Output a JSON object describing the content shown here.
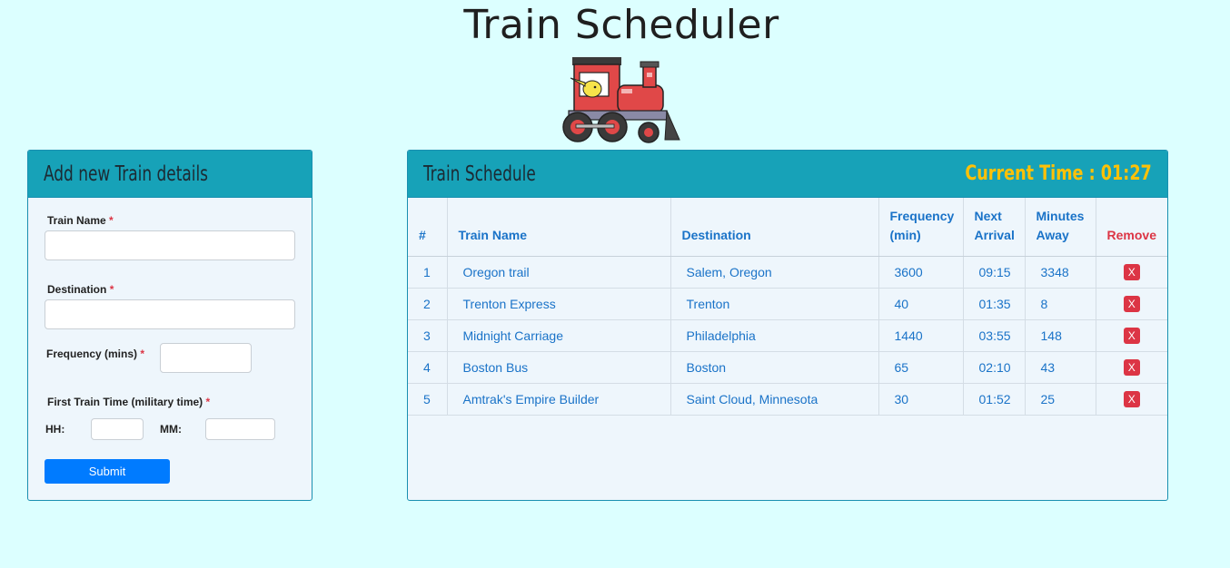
{
  "page": {
    "title": "Train Scheduler"
  },
  "form": {
    "title": "Add new Train details",
    "fields": {
      "train_name": {
        "label": "Train Name",
        "value": ""
      },
      "destination": {
        "label": "Destination",
        "value": ""
      },
      "frequency": {
        "label": "Frequency (mins)",
        "value": ""
      },
      "first_time": {
        "label": "First Train Time (military time)"
      },
      "hh": {
        "label": "HH:",
        "value": ""
      },
      "mm": {
        "label": "MM:",
        "value": ""
      }
    },
    "required_mark": "*",
    "submit_label": "Submit"
  },
  "schedule": {
    "title": "Train Schedule",
    "current_time": "Current Time : 01:27",
    "columns": [
      "#",
      "Train Name",
      "Destination",
      "Frequency (min)",
      "Next Arrival",
      "Minutes Away",
      "Remove"
    ],
    "remove_label": "X",
    "rows": [
      {
        "num": "1",
        "name": "Oregon trail",
        "destination": "Salem, Oregon",
        "frequency": "3600",
        "next": "09:15",
        "away": "3348"
      },
      {
        "num": "2",
        "name": "Trenton Express",
        "destination": "Trenton",
        "frequency": "40",
        "next": "01:35",
        "away": "8"
      },
      {
        "num": "3",
        "name": "Midnight Carriage",
        "destination": "Philadelphia",
        "frequency": "1440",
        "next": "03:55",
        "away": "148"
      },
      {
        "num": "4",
        "name": "Boston Bus",
        "destination": "Boston",
        "frequency": "65",
        "next": "02:10",
        "away": "43"
      },
      {
        "num": "5",
        "name": "Amtrak's Empire Builder",
        "destination": "Saint Cloud, Minnesota",
        "frequency": "30",
        "next": "01:52",
        "away": "25"
      }
    ]
  },
  "colors": {
    "background": "#dcffff",
    "header": "#17a2b8",
    "accent": "#007bff",
    "clock": "#ffc107",
    "danger": "#dc3545"
  }
}
